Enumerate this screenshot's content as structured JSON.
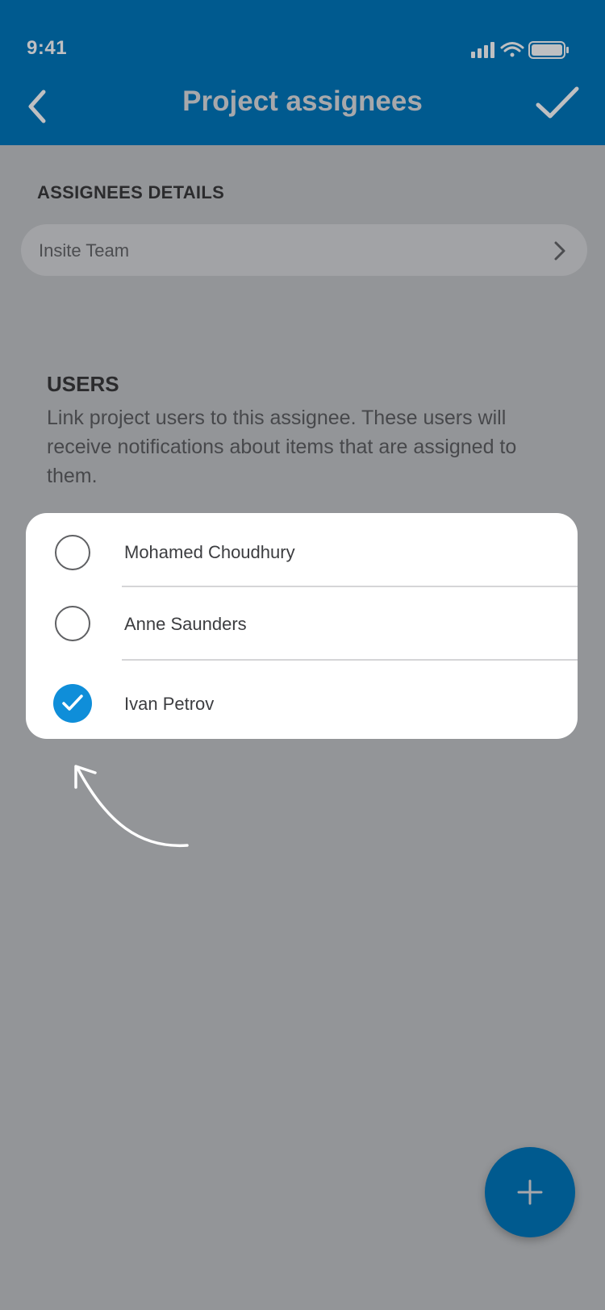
{
  "status_bar": {
    "time": "9:41"
  },
  "nav": {
    "title": "Project assignees",
    "back_icon": "chevron-left-icon",
    "confirm_icon": "checkmark-icon"
  },
  "assignee_details": {
    "section_label": "ASSIGNEES DETAILS",
    "team_name": "Insite Team"
  },
  "users": {
    "heading": "USERS",
    "description": "Link project users to this assignee. These users will receive notifications about items that are assigned to them.",
    "list": [
      {
        "name": "Mohamed Choudhury",
        "checked": false
      },
      {
        "name": "Anne Saunders",
        "checked": false
      },
      {
        "name": "Ivan Petrov",
        "checked": true
      }
    ]
  },
  "fab": {
    "icon": "plus-icon"
  },
  "colors": {
    "header": "#005a8f",
    "accent": "#0f8ed9",
    "overlay": "#939598",
    "card": "#ffffff"
  }
}
